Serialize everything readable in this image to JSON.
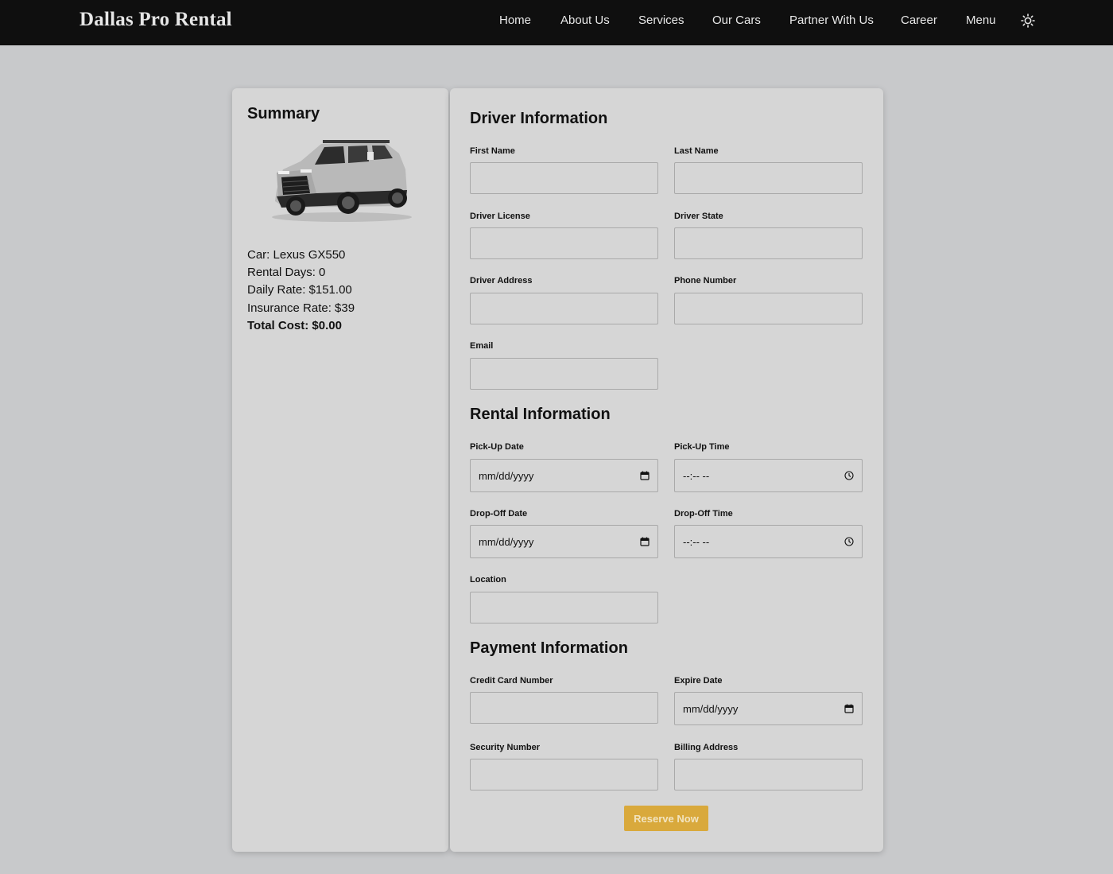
{
  "header": {
    "brand": "Dallas Pro Rental",
    "nav": [
      {
        "label": "Home"
      },
      {
        "label": "About Us"
      },
      {
        "label": "Services"
      },
      {
        "label": "Our Cars"
      },
      {
        "label": "Partner With Us"
      },
      {
        "label": "Career"
      },
      {
        "label": "Menu"
      }
    ],
    "theme_toggle_icon": "sun-icon"
  },
  "summary": {
    "title": "Summary",
    "car_image_icon": "car-photo",
    "car": "Car: Lexus GX550",
    "rental_days": "Rental Days: 0",
    "daily_rate": "Daily Rate: $151.00",
    "insurance_rate": "Insurance Rate: $39",
    "total_cost": "Total Cost: $0.00"
  },
  "driver": {
    "title": "Driver Information",
    "first_name": {
      "label": "First Name",
      "value": ""
    },
    "last_name": {
      "label": "Last Name",
      "value": ""
    },
    "license": {
      "label": "Driver License",
      "value": ""
    },
    "state": {
      "label": "Driver State",
      "value": ""
    },
    "address": {
      "label": "Driver Address",
      "value": ""
    },
    "phone": {
      "label": "Phone Number",
      "value": ""
    },
    "email": {
      "label": "Email",
      "value": ""
    }
  },
  "rental": {
    "title": "Rental Information",
    "pickup_date": {
      "label": "Pick-Up Date",
      "placeholder": "mm/dd/yyyy"
    },
    "pickup_time": {
      "label": "Pick-Up Time",
      "placeholder": "--:-- --"
    },
    "dropoff_date": {
      "label": "Drop-Off Date",
      "placeholder": "mm/dd/yyyy"
    },
    "dropoff_time": {
      "label": "Drop-Off Time",
      "placeholder": "--:-- --"
    },
    "location": {
      "label": "Location",
      "value": ""
    }
  },
  "payment": {
    "title": "Payment Information",
    "card_number": {
      "label": "Credit Card Number",
      "value": ""
    },
    "expire_date": {
      "label": "Expire Date",
      "placeholder": "mm/dd/yyyy"
    },
    "security_number": {
      "label": "Security Number",
      "value": ""
    },
    "billing_address": {
      "label": "Billing Address",
      "value": ""
    },
    "submit_label": "Reserve Now"
  },
  "colors": {
    "header_bg": "#0f0f0f",
    "page_bg": "#c8c9cb",
    "card_bg": "#d6d6d6",
    "accent": "#d9a93c"
  }
}
